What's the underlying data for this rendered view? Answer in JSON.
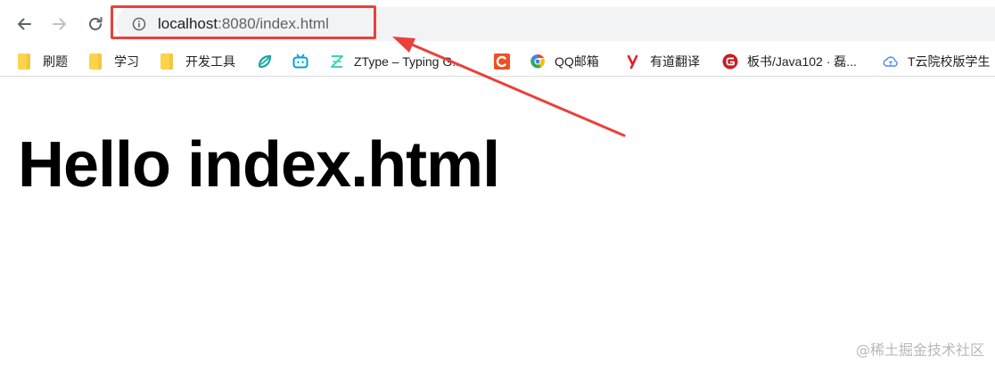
{
  "toolbar": {
    "back_icon": "arrow-left-icon",
    "forward_icon": "arrow-right-icon",
    "reload_icon": "reload-icon",
    "site_info_icon": "info-icon",
    "url_host": "localhost",
    "url_rest": ":8080/index.html",
    "highlight_color": "#e8413b"
  },
  "bookmarks": [
    {
      "label": "刷题",
      "icon": "folder-icon"
    },
    {
      "label": "学习",
      "icon": "folder-icon"
    },
    {
      "label": "开发工具",
      "icon": "folder-icon"
    },
    {
      "label": "",
      "icon": "leaf-logo-icon"
    },
    {
      "label": "",
      "icon": "bilibili-icon"
    },
    {
      "label": "ZType – Typing G...",
      "icon": "ztype-icon"
    },
    {
      "label": "",
      "icon": "c-logo-icon"
    },
    {
      "label": "QQ邮箱",
      "icon": "qqmail-icon"
    },
    {
      "label": "有道翻译",
      "icon": "youdao-icon"
    },
    {
      "label": "板书/Java102 · 磊...",
      "icon": "gitee-icon"
    },
    {
      "label": "T云院校版学生",
      "icon": "cloud-icon"
    }
  ],
  "page": {
    "heading": "Hello index.html"
  },
  "watermark": "@稀土掘金技术社区"
}
